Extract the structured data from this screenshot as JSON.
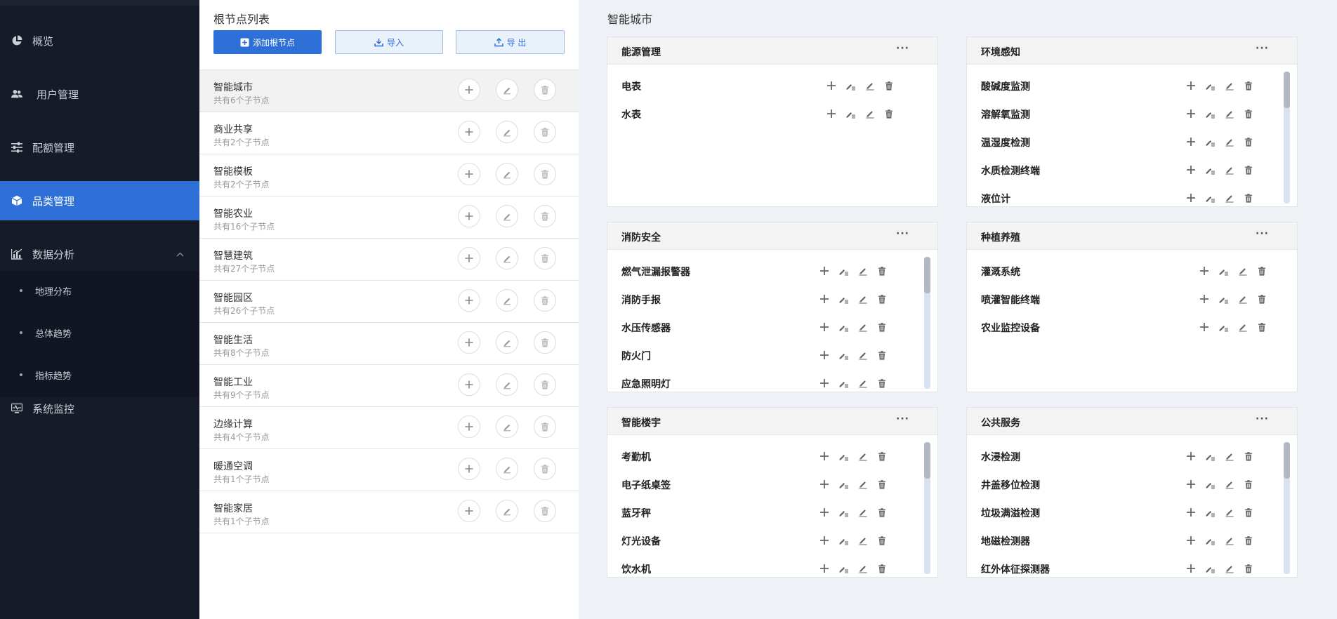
{
  "sidebar": {
    "items": [
      {
        "label": "概览",
        "icon": "pie-chart-icon"
      },
      {
        "label": "用户管理",
        "icon": "users-icon"
      },
      {
        "label": "配额管理",
        "icon": "sliders-icon"
      },
      {
        "label": "品类管理",
        "icon": "cube-icon"
      },
      {
        "label": "数据分析",
        "icon": "bar-chart-icon"
      },
      {
        "label": "系统监控",
        "icon": "monitor-icon"
      }
    ],
    "sub_items": [
      "地理分布",
      "总体趋势",
      "指标趋势"
    ]
  },
  "middle": {
    "title": "根节点列表",
    "add_label": "添加根节点",
    "import_label": "导入",
    "export_label": "导 出",
    "nodes": [
      {
        "name": "智能城市",
        "count": "共有6个子节点"
      },
      {
        "name": "商业共享",
        "count": "共有2个子节点"
      },
      {
        "name": "智能模板",
        "count": "共有2个子节点"
      },
      {
        "name": "智能农业",
        "count": "共有16个子节点"
      },
      {
        "name": "智慧建筑",
        "count": "共有27个子节点"
      },
      {
        "name": "智能园区",
        "count": "共有26个子节点"
      },
      {
        "name": "智能生活",
        "count": "共有8个子节点"
      },
      {
        "name": "智能工业",
        "count": "共有9个子节点"
      },
      {
        "name": "边缘计算",
        "count": "共有4个子节点"
      },
      {
        "name": "暖通空调",
        "count": "共有1个子节点"
      },
      {
        "name": "智能家居",
        "count": "共有1个子节点"
      }
    ]
  },
  "main": {
    "title": "智能城市",
    "more": "···",
    "cards": [
      {
        "title": "能源管理",
        "items": [
          "电表",
          "水表"
        ]
      },
      {
        "title": "环境感知",
        "items": [
          "酸碱度监测",
          "溶解氧监测",
          "温湿度检测",
          "水质检测终端",
          "液位计"
        ]
      },
      {
        "title": "消防安全",
        "items": [
          "燃气泄漏报警器",
          "消防手报",
          "水压传感器",
          "防火门",
          "应急照明灯"
        ]
      },
      {
        "title": "种植养殖",
        "items": [
          "灌溉系统",
          "喷灌智能终端",
          "农业监控设备"
        ]
      },
      {
        "title": "智能楼宇",
        "items": [
          "考勤机",
          "电子纸桌签",
          "蓝牙秤",
          "灯光设备",
          "饮水机"
        ]
      },
      {
        "title": "公共服务",
        "items": [
          "水浸检测",
          "井盖移位检测",
          "垃圾满溢检测",
          "地磁检测器",
          "红外体征探测器"
        ]
      }
    ]
  }
}
